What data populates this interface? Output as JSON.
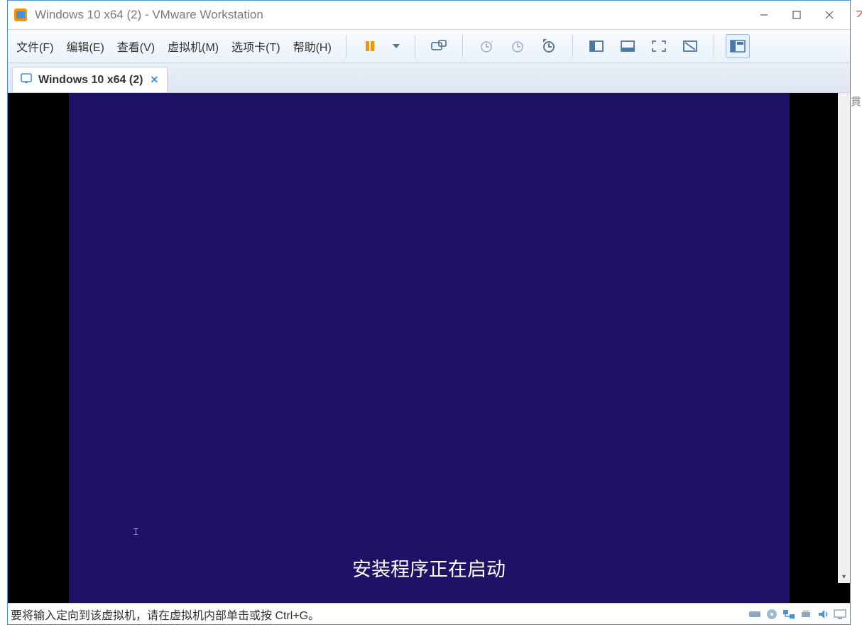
{
  "titlebar": {
    "title": "Windows 10 x64 (2) - VMware Workstation"
  },
  "menubar": {
    "file": "文件(F)",
    "edit": "编辑(E)",
    "view": "查看(V)",
    "vm": "虚拟机(M)",
    "tabs": "选项卡(T)",
    "help": "帮助(H)"
  },
  "tab": {
    "label": "Windows 10 x64 (2)"
  },
  "vm_content": {
    "setup_message": "安装程序正在启动"
  },
  "statusbar": {
    "hint": "要将输入定向到该虚拟机，请在虚拟机内部单击或按 Ctrl+G。"
  },
  "colors": {
    "vm_bg": "#1e1267",
    "accent": "#4a90d9"
  }
}
